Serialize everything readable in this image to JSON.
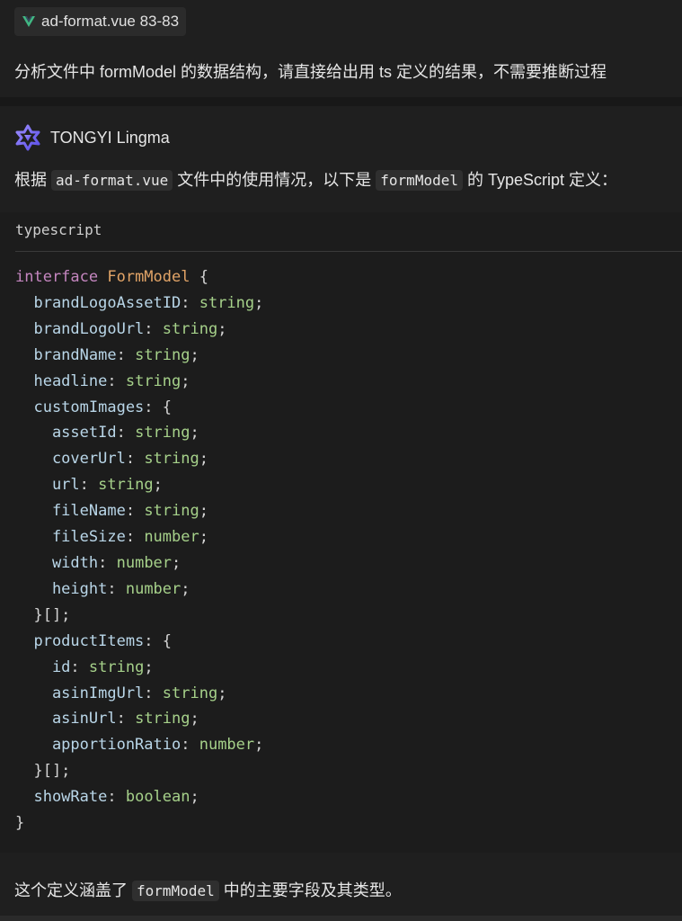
{
  "user_message": {
    "file_chip": {
      "icon": "vue-icon",
      "label": "ad-format.vue 83-83"
    },
    "text": "分析文件中 formModel 的数据结构，请直接给出用 ts 定义的结果，不需要推断过程"
  },
  "assistant": {
    "name": "TONGYI Lingma",
    "icon": "lingma-logo-icon",
    "intro": {
      "part1": "根据",
      "code1": "ad-format.vue",
      "part2": "文件中的使用情况，以下是",
      "code2": "formModel",
      "part3": "的 TypeScript 定义："
    },
    "code_block": {
      "language": "typescript",
      "lines": [
        [
          {
            "t": "kw",
            "v": "interface "
          },
          {
            "t": "type",
            "v": "FormModel"
          },
          {
            "t": "punc",
            "v": " {"
          }
        ],
        [
          {
            "t": "prop",
            "v": "  brandLogoAssetID"
          },
          {
            "t": "punc",
            "v": ": "
          },
          {
            "t": "str",
            "v": "string"
          },
          {
            "t": "punc",
            "v": ";"
          }
        ],
        [
          {
            "t": "prop",
            "v": "  brandLogoUrl"
          },
          {
            "t": "punc",
            "v": ": "
          },
          {
            "t": "str",
            "v": "string"
          },
          {
            "t": "punc",
            "v": ";"
          }
        ],
        [
          {
            "t": "prop",
            "v": "  brandName"
          },
          {
            "t": "punc",
            "v": ": "
          },
          {
            "t": "str",
            "v": "string"
          },
          {
            "t": "punc",
            "v": ";"
          }
        ],
        [
          {
            "t": "prop",
            "v": "  headline"
          },
          {
            "t": "punc",
            "v": ": "
          },
          {
            "t": "str",
            "v": "string"
          },
          {
            "t": "punc",
            "v": ";"
          }
        ],
        [
          {
            "t": "prop",
            "v": "  customImages"
          },
          {
            "t": "punc",
            "v": ": {"
          }
        ],
        [
          {
            "t": "prop",
            "v": "    assetId"
          },
          {
            "t": "punc",
            "v": ": "
          },
          {
            "t": "str",
            "v": "string"
          },
          {
            "t": "punc",
            "v": ";"
          }
        ],
        [
          {
            "t": "prop",
            "v": "    coverUrl"
          },
          {
            "t": "punc",
            "v": ": "
          },
          {
            "t": "str",
            "v": "string"
          },
          {
            "t": "punc",
            "v": ";"
          }
        ],
        [
          {
            "t": "prop",
            "v": "    url"
          },
          {
            "t": "punc",
            "v": ": "
          },
          {
            "t": "str",
            "v": "string"
          },
          {
            "t": "punc",
            "v": ";"
          }
        ],
        [
          {
            "t": "prop",
            "v": "    fileName"
          },
          {
            "t": "punc",
            "v": ": "
          },
          {
            "t": "str",
            "v": "string"
          },
          {
            "t": "punc",
            "v": ";"
          }
        ],
        [
          {
            "t": "prop",
            "v": "    fileSize"
          },
          {
            "t": "punc",
            "v": ": "
          },
          {
            "t": "num",
            "v": "number"
          },
          {
            "t": "punc",
            "v": ";"
          }
        ],
        [
          {
            "t": "prop",
            "v": "    width"
          },
          {
            "t": "punc",
            "v": ": "
          },
          {
            "t": "num",
            "v": "number"
          },
          {
            "t": "punc",
            "v": ";"
          }
        ],
        [
          {
            "t": "prop",
            "v": "    height"
          },
          {
            "t": "punc",
            "v": ": "
          },
          {
            "t": "num",
            "v": "number"
          },
          {
            "t": "punc",
            "v": ";"
          }
        ],
        [
          {
            "t": "punc",
            "v": "  }[];"
          }
        ],
        [
          {
            "t": "prop",
            "v": "  productItems"
          },
          {
            "t": "punc",
            "v": ": {"
          }
        ],
        [
          {
            "t": "prop",
            "v": "    id"
          },
          {
            "t": "punc",
            "v": ": "
          },
          {
            "t": "str",
            "v": "string"
          },
          {
            "t": "punc",
            "v": ";"
          }
        ],
        [
          {
            "t": "prop",
            "v": "    asinImgUrl"
          },
          {
            "t": "punc",
            "v": ": "
          },
          {
            "t": "str",
            "v": "string"
          },
          {
            "t": "punc",
            "v": ";"
          }
        ],
        [
          {
            "t": "prop",
            "v": "    asinUrl"
          },
          {
            "t": "punc",
            "v": ": "
          },
          {
            "t": "str",
            "v": "string"
          },
          {
            "t": "punc",
            "v": ";"
          }
        ],
        [
          {
            "t": "prop",
            "v": "    apportionRatio"
          },
          {
            "t": "punc",
            "v": ": "
          },
          {
            "t": "num",
            "v": "number"
          },
          {
            "t": "punc",
            "v": ";"
          }
        ],
        [
          {
            "t": "punc",
            "v": "  }[];"
          }
        ],
        [
          {
            "t": "prop",
            "v": "  showRate"
          },
          {
            "t": "punc",
            "v": ": "
          },
          {
            "t": "bool",
            "v": "boolean"
          },
          {
            "t": "punc",
            "v": ";"
          }
        ],
        [
          {
            "t": "punc",
            "v": "}"
          }
        ]
      ]
    },
    "outro": {
      "part1": "这个定义涵盖了",
      "code1": "formModel",
      "part2": "中的主要字段及其类型。"
    }
  },
  "colors": {
    "background": "#1f1f1f",
    "keyword": "#c586c0",
    "type_name": "#e2a467",
    "property": "#b9d6e8",
    "type_value": "#a6d18a",
    "vue_green": "#41b883",
    "lingma_purple": "#7b6cf6"
  }
}
